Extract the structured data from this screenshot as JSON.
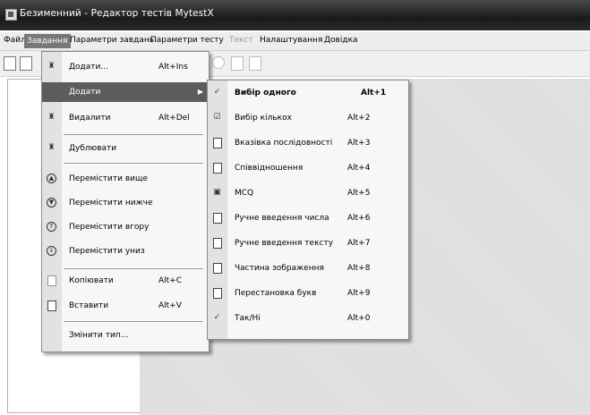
{
  "window": {
    "title": "Безименний - Редактор тестів MytestX"
  },
  "menubar": {
    "items": [
      "Файл",
      "Завдання",
      "Параметри завдань",
      "Параметри тесту",
      "Текст",
      "Налаштування",
      "Довідка"
    ],
    "active": "Завдання",
    "disabled": [
      "Текст"
    ]
  },
  "task_menu": {
    "items": [
      {
        "label": "Додати...",
        "shortcut": "Alt+Ins",
        "icon": "add-task-icon"
      },
      {
        "label": "Додати",
        "shortcut": "",
        "icon": "",
        "submenu": true,
        "highlighted": true
      },
      {
        "label": "Видалити",
        "shortcut": "Alt+Del",
        "icon": "delete-task-icon"
      },
      {
        "label": "Дублювати",
        "shortcut": "",
        "icon": "duplicate-task-icon"
      },
      {
        "label": "Перемістити вище",
        "shortcut": "",
        "icon": "move-up-icon"
      },
      {
        "label": "Перемістити нижче",
        "shortcut": "",
        "icon": "move-down-icon"
      },
      {
        "label": "Перемістити вгору",
        "shortcut": "",
        "icon": "move-top-icon"
      },
      {
        "label": "Перемістити униз",
        "shortcut": "",
        "icon": "move-bottom-icon"
      },
      {
        "label": "Копіювати",
        "shortcut": "Alt+C",
        "icon": "copy-icon"
      },
      {
        "label": "Вставити",
        "shortcut": "Alt+V",
        "icon": "paste-icon"
      },
      {
        "label": "Змінити тип...",
        "shortcut": "",
        "icon": ""
      }
    ]
  },
  "add_submenu": {
    "items": [
      {
        "label": "Вибір одного",
        "shortcut": "Alt+1",
        "icon": "single-choice-icon",
        "bold": true
      },
      {
        "label": "Вибір кількох",
        "shortcut": "Alt+2",
        "icon": "multiple-choice-icon"
      },
      {
        "label": "Вказівка послідовності",
        "shortcut": "Alt+3",
        "icon": "sequence-icon"
      },
      {
        "label": "Співвідношення",
        "shortcut": "Alt+4",
        "icon": "matching-icon"
      },
      {
        "label": "MCQ",
        "shortcut": "Alt+5",
        "icon": "mcq-icon"
      },
      {
        "label": "Ручне введення числа",
        "shortcut": "Alt+6",
        "icon": "number-input-icon"
      },
      {
        "label": "Ручне введення тексту",
        "shortcut": "Alt+7",
        "icon": "text-input-icon"
      },
      {
        "label": "Частина зображення",
        "shortcut": "Alt+8",
        "icon": "image-area-icon"
      },
      {
        "label": "Перестановка букв",
        "shortcut": "Alt+9",
        "icon": "letter-permutation-icon"
      },
      {
        "label": "Так/Ні",
        "shortcut": "Alt+0",
        "icon": "yes-no-icon"
      }
    ]
  }
}
